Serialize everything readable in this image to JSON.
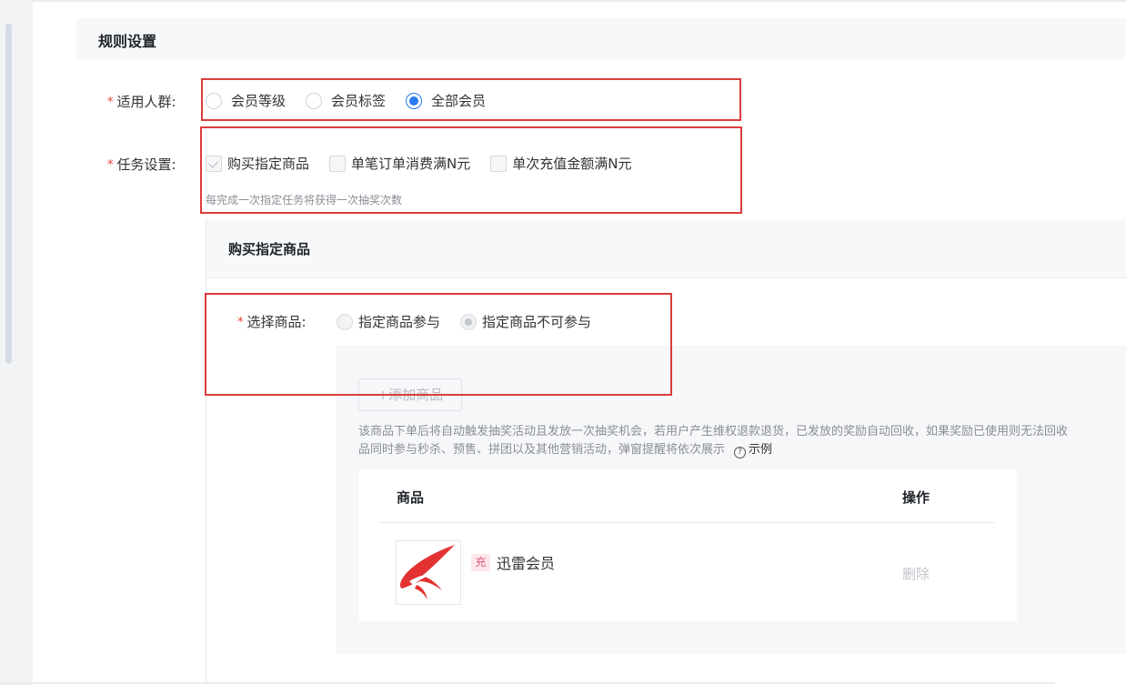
{
  "section": {
    "title": "规则设置"
  },
  "audience": {
    "label": "适用人群:",
    "options": [
      "会员等级",
      "会员标签",
      "全部会员"
    ],
    "selected": "全部会员"
  },
  "task": {
    "label": "任务设置:",
    "options": [
      "购买指定商品",
      "单笔订单消费满N元",
      "单次充值金额满N元"
    ],
    "checked": [
      "购买指定商品"
    ],
    "hint": "每完成一次指定任务将获得一次抽奖次数"
  },
  "purchase": {
    "title": "购买指定商品",
    "select_label": "选择商品:",
    "options": [
      "指定商品参与",
      "指定商品不可参与"
    ],
    "selected": "指定商品不可参与",
    "add_button": "+添加商品",
    "desc_line1": "该商品下单后将自动触发抽奖活动且发放一次抽奖机会，若用户产生维权退款退货，已发放的奖励自动回收，如果奖励已使用则无法回收",
    "desc_line2": "品同时参与秒杀、预售、拼团以及其他营销活动，弹窗提醒将依次展示",
    "example_link": "示例",
    "table": {
      "headers": {
        "goods": "商品",
        "action": "操作"
      },
      "rows": [
        {
          "tag": "充",
          "name": "迅雷会员",
          "action": "删除"
        }
      ]
    }
  },
  "colors": {
    "accent": "#2b7bf2",
    "required": "#e33e33",
    "annotation": "#dc3c3c"
  }
}
